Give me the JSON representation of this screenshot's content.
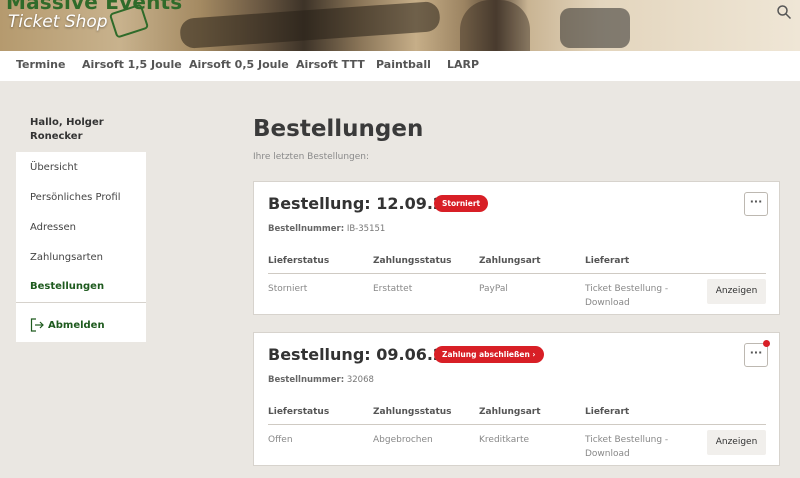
{
  "header": {
    "logo_title": "Massive Events",
    "logo_subtitle": "Ticket Shop"
  },
  "nav": {
    "items": [
      "Termine",
      "Airsoft 1,5 Joule",
      "Airsoft 0,5 Joule",
      "Airsoft TTT",
      "Paintball",
      "LARP"
    ]
  },
  "sidebar": {
    "greeting": "Hallo, Holger Ronecker",
    "items": [
      "Übersicht",
      "Persönliches Profil",
      "Adressen",
      "Zahlungsarten",
      "Bestellungen"
    ],
    "active": "Bestellungen",
    "logout_label": "Abmelden"
  },
  "main": {
    "title": "Bestellungen",
    "subtitle": "Ihre letzten Bestellungen:",
    "columns": [
      "Lieferstatus",
      "Zahlungsstatus",
      "Zahlungsart",
      "Lieferart"
    ],
    "orders": [
      {
        "title": "Bestellung: 12.09.21",
        "badge": "Storniert",
        "order_number_label": "Bestellnummer:",
        "order_number": "IB-35151",
        "lieferstatus": "Storniert",
        "zahlungsstatus": "Erstattet",
        "zahlungsart": "PayPal",
        "lieferart_line1": "Ticket Bestellung -",
        "lieferart_line2": "Download",
        "menu": "···",
        "show_label": "Anzeigen"
      },
      {
        "title": "Bestellung: 09.06.21",
        "badge": "Zahlung abschließen ›",
        "order_number_label": "Bestellnummer:",
        "order_number": "32068",
        "lieferstatus": "Offen",
        "zahlungsstatus": "Abgebrochen",
        "zahlungsart": "Kreditkarte",
        "lieferart_line1": "Ticket Bestellung -",
        "lieferart_line2": "Download",
        "menu": "···",
        "show_label": "Anzeigen"
      }
    ]
  },
  "colors": {
    "brand_green": "#1e5a1e",
    "badge_red": "#d81f26",
    "background": "#eae7e2"
  }
}
